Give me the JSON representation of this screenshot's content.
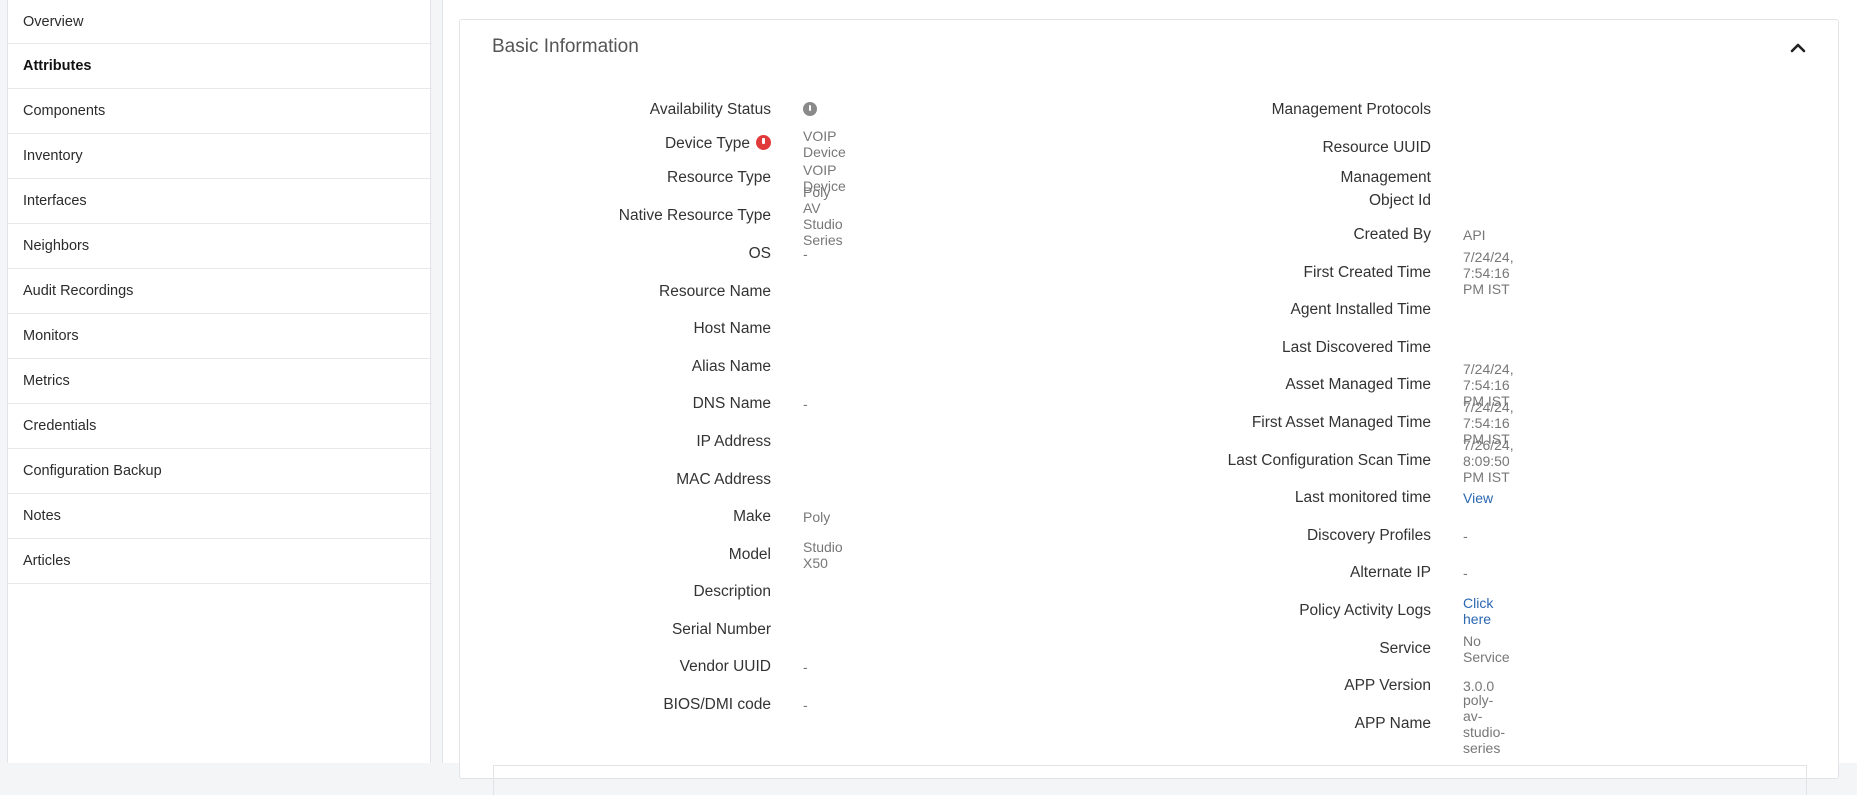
{
  "sidebar": {
    "items": [
      {
        "label": "Overview"
      },
      {
        "label": "Attributes"
      },
      {
        "label": "Components"
      },
      {
        "label": "Inventory"
      },
      {
        "label": "Interfaces"
      },
      {
        "label": "Neighbors"
      },
      {
        "label": "Audit Recordings"
      },
      {
        "label": "Monitors"
      },
      {
        "label": "Metrics"
      },
      {
        "label": "Credentials"
      },
      {
        "label": "Configuration Backup"
      },
      {
        "label": "Notes"
      },
      {
        "label": "Articles"
      }
    ],
    "active": "Attributes"
  },
  "panel": {
    "title": "Basic Information",
    "collapse_icon": "chevron-up-icon"
  },
  "left": [
    {
      "label": "Availability Status",
      "value": "",
      "icon": "info-icon"
    },
    {
      "label": "Device Type",
      "value": "VOIP Device",
      "label_icon": "error-icon"
    },
    {
      "label": "Resource Type",
      "value": "VOIP Device"
    },
    {
      "label": "Native Resource Type",
      "value": "Poly AV Studio Series"
    },
    {
      "label": "OS",
      "value": "-"
    },
    {
      "label": "Resource Name",
      "value": ""
    },
    {
      "label": "Host Name",
      "value": ""
    },
    {
      "label": "Alias Name",
      "value": ""
    },
    {
      "label": "DNS Name",
      "value": "-"
    },
    {
      "label": "IP Address",
      "value": ""
    },
    {
      "label": "MAC Address",
      "value": ""
    },
    {
      "label": "Make",
      "value": "Poly"
    },
    {
      "label": "Model",
      "value": "Studio X50"
    },
    {
      "label": "Description",
      "value": ""
    },
    {
      "label": "Serial Number",
      "value": ""
    },
    {
      "label": "Vendor UUID",
      "value": "-"
    },
    {
      "label": "BIOS/DMI code",
      "value": "-"
    }
  ],
  "right": [
    {
      "label": "Management Protocols",
      "value": ""
    },
    {
      "label": "Resource UUID",
      "value": ""
    },
    {
      "label": "Management",
      "label2": "Object Id",
      "value": ""
    },
    {
      "label": "Created By",
      "value": "API"
    },
    {
      "label": "First Created Time",
      "value": "7/24/24, 7:54:16 PM IST"
    },
    {
      "label": "Agent Installed Time",
      "value": ""
    },
    {
      "label": "Last Discovered Time",
      "value": ""
    },
    {
      "label": "Asset Managed Time",
      "value": "7/24/24, 7:54:16 PM IST"
    },
    {
      "label": "First Asset Managed Time",
      "value": "7/24/24, 7:54:16 PM IST"
    },
    {
      "label": "Last Configuration Scan Time",
      "value": "7/26/24, 8:09:50 PM IST"
    },
    {
      "label": "Last monitored time",
      "value": "View"
    },
    {
      "label": "Discovery Profiles",
      "value": "-"
    },
    {
      "label": "Alternate IP",
      "value": "-"
    },
    {
      "label": "Policy Activity Logs",
      "value": "Click here"
    },
    {
      "label": "Service",
      "value": "No Service"
    },
    {
      "label": "APP Version",
      "value": "3.0.0"
    },
    {
      "label": "APP Name",
      "value": "poly-av-studio-series"
    }
  ]
}
